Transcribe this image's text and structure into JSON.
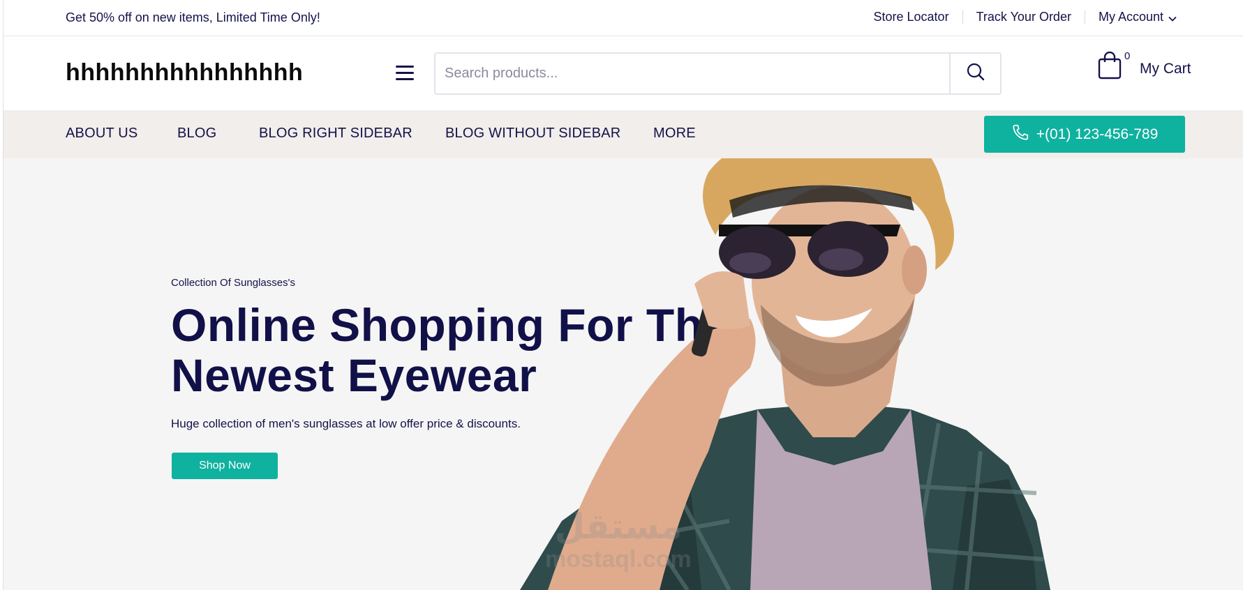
{
  "topbar": {
    "promo": "Get 50% off on new items, Limited Time Only!",
    "links": [
      "Store Locator",
      "Track Your Order",
      "My Account"
    ]
  },
  "header": {
    "logo": "hhhhhhhhhhhhhhhh",
    "search_placeholder": "Search products...",
    "cart_count": "0",
    "cart_label": "My Cart"
  },
  "nav": {
    "items": [
      "ABOUT US",
      "BLOG",
      "BLOG RIGHT SIDEBAR",
      "BLOG WITHOUT SIDEBAR",
      "MORE"
    ],
    "phone": "+(01) 123-456-789"
  },
  "hero": {
    "eyebrow": "Collection Of Sunglasses's",
    "headline_line1": "Online Shopping For The",
    "headline_line2": "Newest Eyewear",
    "subtext": "Huge collection of men's sunglasses at low offer price & discounts.",
    "cta": "Shop Now",
    "watermark_ar": "مستقل",
    "watermark_en": "mostaql.com"
  },
  "colors": {
    "accent": "#0fb19f",
    "navy": "#14124a",
    "nav_bg": "#f1eeeb",
    "hero_bg": "#f5f5f5"
  },
  "icons": [
    "chevron-down-icon",
    "menu-icon",
    "search-icon",
    "shopping-bag-icon",
    "phone-icon"
  ]
}
